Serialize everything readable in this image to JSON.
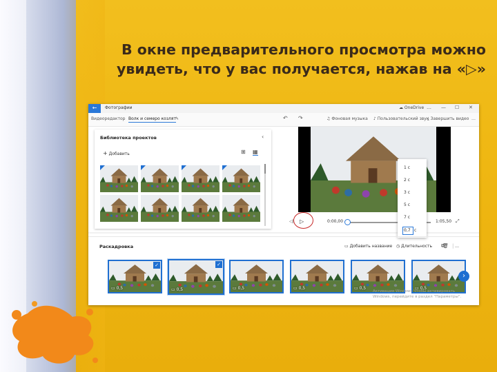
{
  "slide": {
    "caption": "В окне предварительного просмотра можно увидеть, что у вас получается, нажав на «▷»"
  },
  "window": {
    "app_title": "Фотографии",
    "onedrive_label": "OneDrive",
    "back_glyph": "←",
    "controls": [
      "…",
      "—",
      "☐",
      "✕"
    ]
  },
  "toolbar": {
    "editor_label": "Видеоредактор",
    "project_name": "Волк и семеро козлят",
    "undo_icon": "undo-icon",
    "redo_icon": "redo-icon",
    "music_label": "Фоновая музыка",
    "custom_audio_label": "Пользовательский звук",
    "finish_label": "Завершить видео",
    "more": "…"
  },
  "library": {
    "title": "Библиотека проектов",
    "add_label": "Добавить",
    "collapse": "‹"
  },
  "player": {
    "time_current": "0:00,00",
    "time_total": "1:05,50",
    "progress": 0.0
  },
  "duration_menu": {
    "options": [
      "1 с",
      "2 с",
      "3 с",
      "5 с",
      "7 с"
    ],
    "input_value": "0,7",
    "unit": "с"
  },
  "storyboard": {
    "title": "Раскадровка",
    "add_title_label": "Добавить название",
    "duration_label": "Длительность",
    "more": "…",
    "clips": [
      {
        "duration": "0,5",
        "checked": true
      },
      {
        "duration": "0,5",
        "checked": true
      },
      {
        "duration": "0,5",
        "checked": false
      },
      {
        "duration": "0,5",
        "checked": false
      },
      {
        "duration": "0,5",
        "checked": false
      },
      {
        "duration": "0,5",
        "checked": false
      }
    ],
    "watermark": "Активация Windows\nЧтобы активировать Windows, перейдите в раздел \"Параметры\"."
  },
  "colors": {
    "accent": "#1f6fd1",
    "highlight_ring": "#c62828",
    "slide_background": "#efb712",
    "caption_text": "#3a2a1a"
  }
}
